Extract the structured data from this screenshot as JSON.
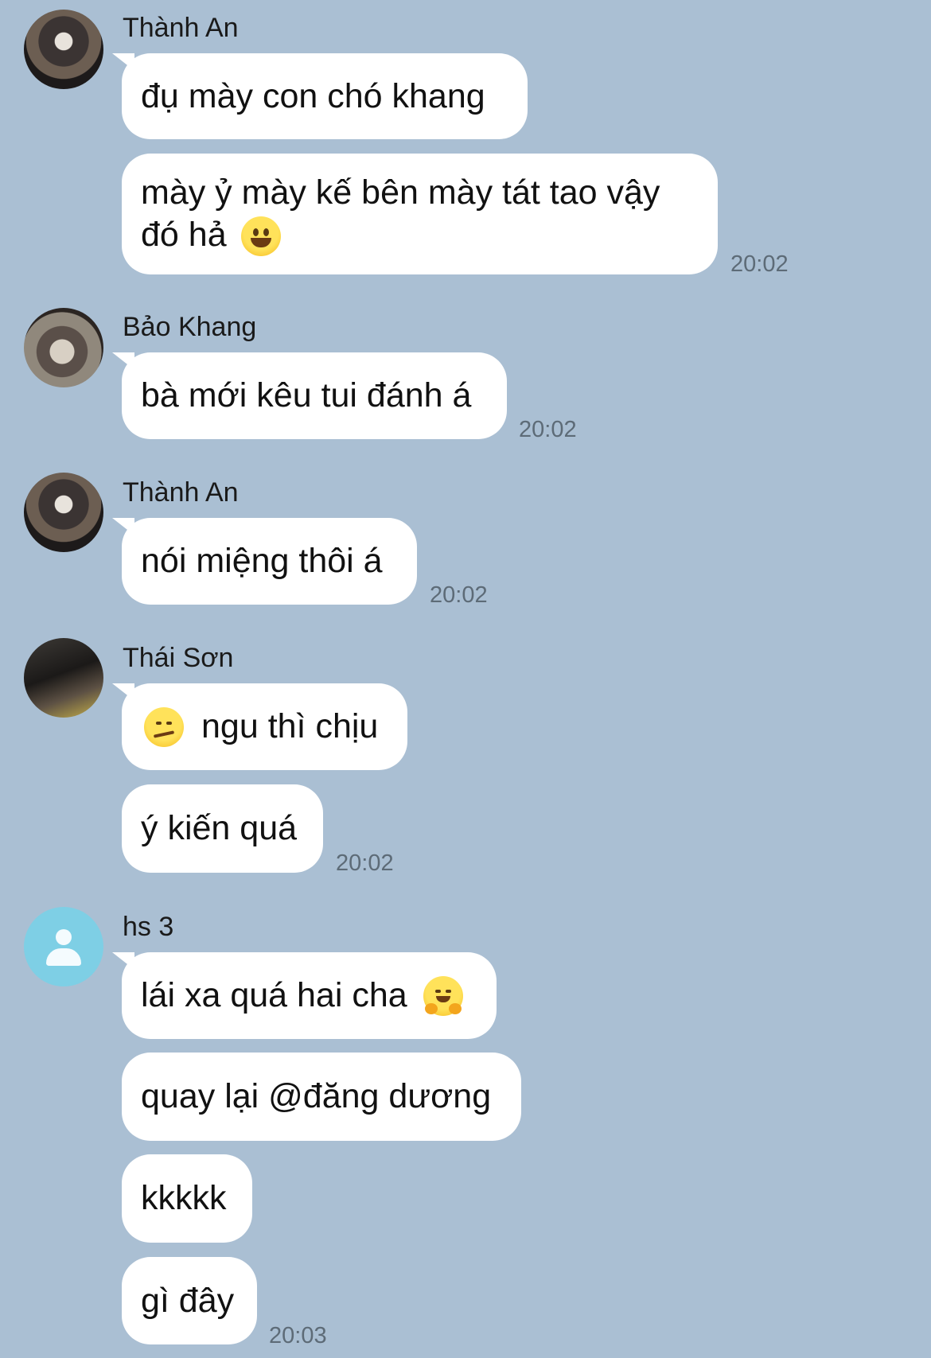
{
  "groups": [
    {
      "sender": "Thành An",
      "messages": [
        {
          "text": "đụ mày con chó khang",
          "emoji": ""
        },
        {
          "text": "mày ỷ mày kế bên mày tát tao vậy\nđó hả",
          "emoji": "grinning-face"
        }
      ],
      "time": "20:02"
    },
    {
      "sender": "Bảo Khang",
      "messages": [
        {
          "text": "bà mới kêu tui đánh á",
          "emoji": ""
        }
      ],
      "time": "20:02"
    },
    {
      "sender": "Thành An",
      "messages": [
        {
          "text": "nói miệng thôi á",
          "emoji": ""
        }
      ],
      "time": "20:02"
    },
    {
      "sender": "Thái Sơn",
      "messages": [
        {
          "text": "ngu thì chịu",
          "emoji": "smirking-face"
        },
        {
          "text": "ý kiến quá",
          "emoji": ""
        }
      ],
      "time": "20:02"
    },
    {
      "sender": "hs 3",
      "messages": [
        {
          "text": "lái xa quá hai cha",
          "emoji": "hugging-face"
        },
        {
          "text": "quay lại @đăng dương",
          "emoji": ""
        },
        {
          "text": "kkkkk",
          "emoji": ""
        },
        {
          "text": "gì đây",
          "emoji": ""
        }
      ],
      "time": "20:03"
    }
  ],
  "colors": {
    "background": "#aabfd3",
    "bubble": "#ffffff",
    "timestamp": "#5d6b77",
    "placeholder_avatar": "#7ecfe5"
  },
  "icons": [
    "user-placeholder-icon",
    "grinning-face-emoji-icon",
    "smirking-face-emoji-icon",
    "hugging-face-emoji-icon"
  ]
}
